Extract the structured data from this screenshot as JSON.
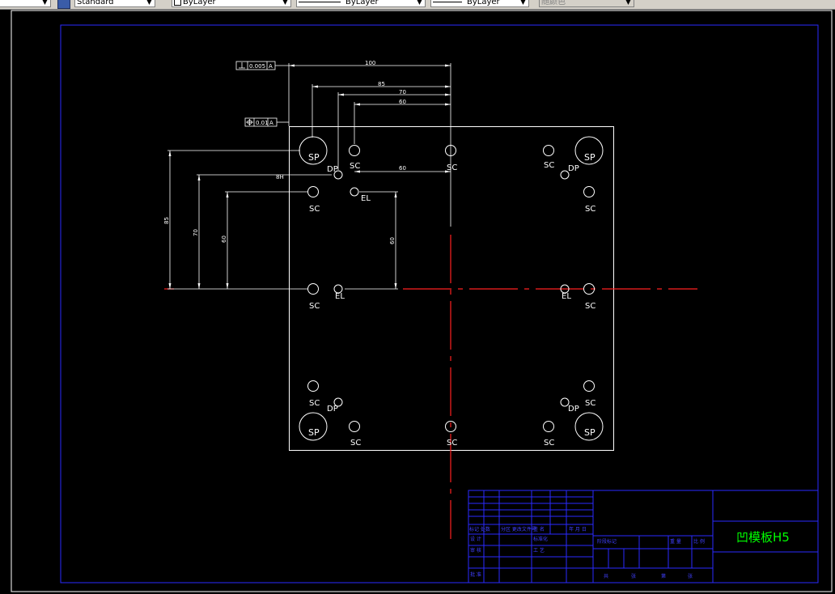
{
  "toolbar": {
    "textstyle_value": "Standard",
    "layer_value": "ByLayer",
    "linetype_value": "ByLayer",
    "lineweight_value": "ByLayer",
    "plotstyle_value": "随颜色"
  },
  "drawing": {
    "tolerance_1_value": "0.005",
    "tolerance_1_datum": "A",
    "tolerance_2_value": "0.01",
    "tolerance_2_datum": "A",
    "dim_top": [
      "100",
      "85",
      "70",
      "60"
    ],
    "dim_left": [
      "85",
      "70",
      "60"
    ],
    "dim_inner_horizontal": "60",
    "dim_inner_vertical": "60",
    "dim_small": "8H",
    "hole_labels": {
      "sp": "SP",
      "sc": "SC",
      "dp": "DP",
      "el": "EL"
    }
  },
  "title_block": {
    "part_name": "凹模板H5",
    "row_labels": [
      "标记 处数",
      "分区 更改文件号",
      "签 名",
      "年 月 日",
      "设 计",
      "标准化",
      "审 核",
      "工 艺",
      "批 准"
    ],
    "center_labels": [
      "阶段标记",
      "重 量",
      "比 例"
    ],
    "bottom_labels": [
      "共",
      "张",
      "第",
      "张"
    ]
  },
  "colors": {
    "drawing_line": "#ffffff",
    "frame": "#2a2aff",
    "centerline": "#ff2020",
    "part_name": "#00ff00",
    "background": "#000000",
    "toolbar": "#d4d0c8"
  }
}
